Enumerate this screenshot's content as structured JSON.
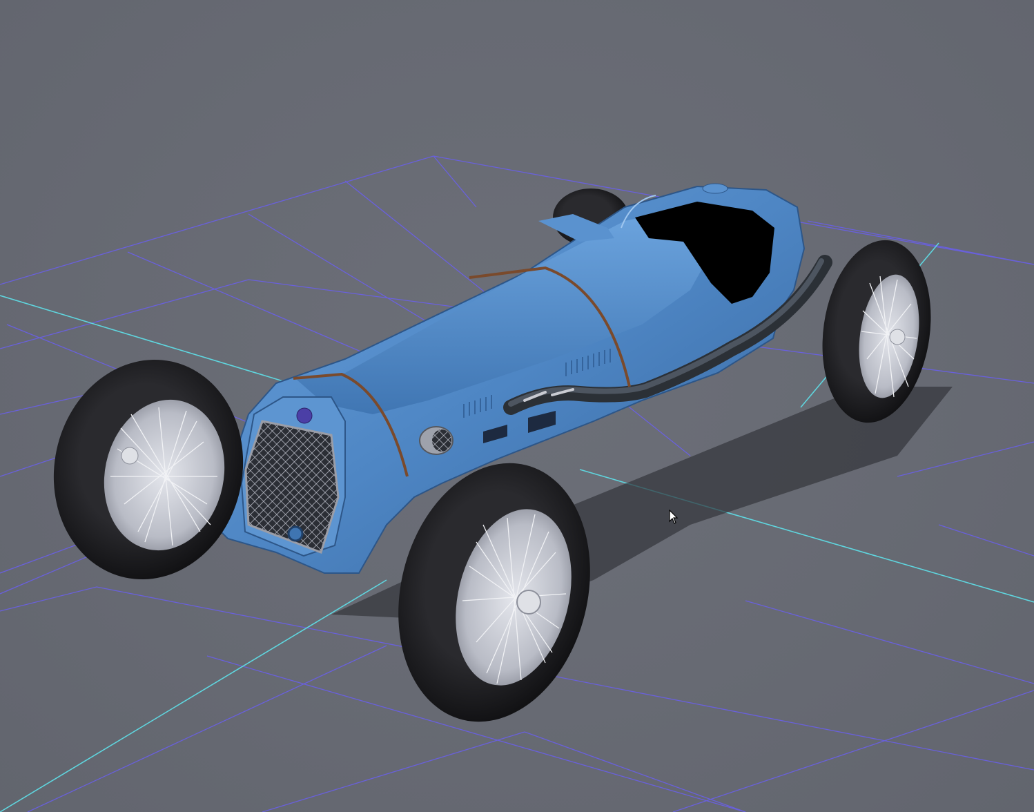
{
  "viewport": {
    "background_color": "#676a73",
    "grid_color": "#6a5ff0",
    "axis_color": "#5fd6df",
    "car_body_color": "#4e86c4",
    "tire_color": "#1a1a1c",
    "rim_color": "#c9cbd2",
    "strap_color": "#7a4a2c",
    "cockpit_color": "#000000",
    "cursor_icon": "arrow-pointer-icon"
  }
}
